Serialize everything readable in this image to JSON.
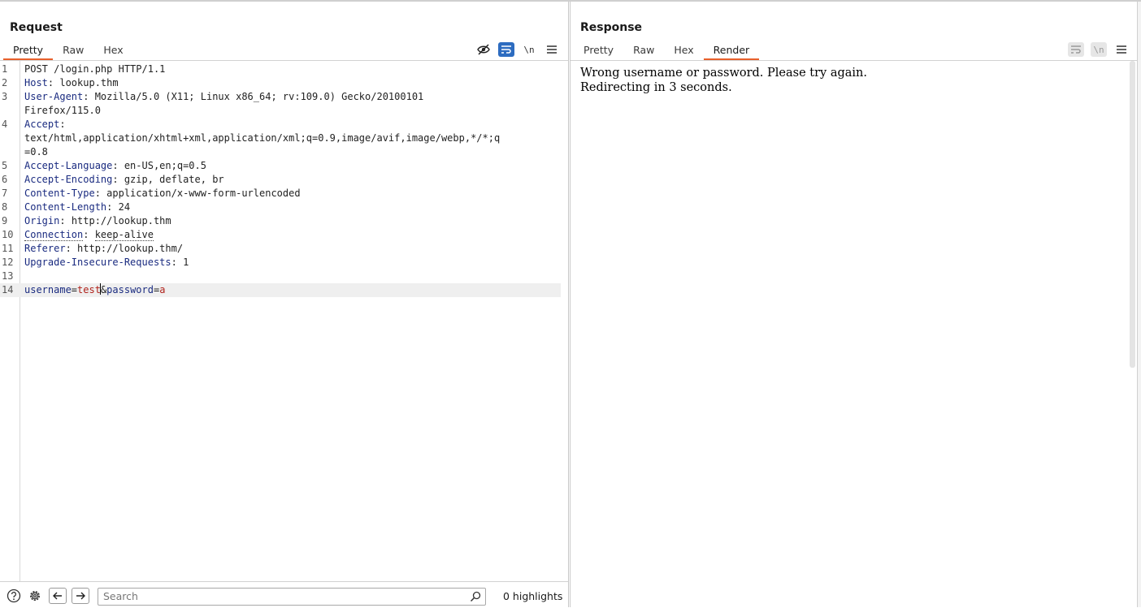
{
  "request": {
    "title": "Request",
    "tabs": [
      {
        "label": "Pretty",
        "active": true
      },
      {
        "label": "Raw",
        "active": false
      },
      {
        "label": "Hex",
        "active": false
      }
    ],
    "newline_toggle": "\\n",
    "lines": [
      {
        "n": "1",
        "text": "POST /login.php HTTP/1.1"
      },
      {
        "n": "2",
        "name": "Host",
        "value": "lookup.thm"
      },
      {
        "n": "3",
        "name": "User-Agent",
        "value": "Mozilla/5.0 (X11; Linux x86_64; rv:109.0) Gecko/20100101"
      },
      {
        "n": "",
        "text": "Firefox/115.0"
      },
      {
        "n": "4",
        "name": "Accept",
        "value": ""
      },
      {
        "n": "",
        "text": "text/html,application/xhtml+xml,application/xml;q=0.9,image/avif,image/webp,*/*;q"
      },
      {
        "n": "",
        "text": "=0.8"
      },
      {
        "n": "5",
        "name": "Accept-Language",
        "value": "en-US,en;q=0.5"
      },
      {
        "n": "6",
        "name": "Accept-Encoding",
        "value": "gzip, deflate, br"
      },
      {
        "n": "7",
        "name": "Content-Type",
        "value": "application/x-www-form-urlencoded"
      },
      {
        "n": "8",
        "name": "Content-Length",
        "value": "24"
      },
      {
        "n": "9",
        "name": "Origin",
        "value": "http://lookup.thm"
      },
      {
        "n": "10",
        "name": "Connection",
        "value": "keep-alive"
      },
      {
        "n": "11",
        "name": "Referer",
        "value": "http://lookup.thm/"
      },
      {
        "n": "12",
        "name": "Upgrade-Insecure-Requests",
        "value": "1"
      },
      {
        "n": "13",
        "text": ""
      }
    ],
    "body": {
      "n": "14",
      "key1": "username",
      "eq": "=",
      "val1": "test",
      "amp": "&",
      "key2": "password",
      "val2": "a"
    }
  },
  "bottom": {
    "search_placeholder": "Search",
    "highlights": "0 highlights"
  },
  "response": {
    "title": "Response",
    "tabs": [
      {
        "label": "Pretty",
        "active": false
      },
      {
        "label": "Raw",
        "active": false
      },
      {
        "label": "Hex",
        "active": false
      },
      {
        "label": "Render",
        "active": true
      }
    ],
    "newline_toggle": "\\n",
    "render_lines": [
      "Wrong username or password. Please try again.",
      "Redirecting in 3 seconds."
    ]
  },
  "colors": {
    "accent_tab": "#e8602c",
    "active_button": "#2d6cc0",
    "header_name": "#1a2b80",
    "param_value": "#b0221b"
  }
}
